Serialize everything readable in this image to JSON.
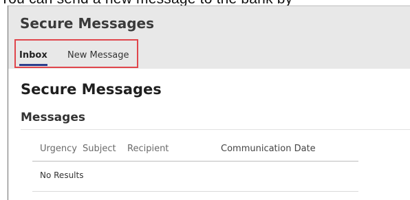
{
  "caption": {
    "text": "You can send a new message to the bank by"
  },
  "header": {
    "app_title": "Secure Messages",
    "tabs": [
      {
        "label": "Inbox",
        "active": true
      },
      {
        "label": "New Message",
        "active": false
      }
    ]
  },
  "colors": {
    "header_bg": "#e8e8e8",
    "active_tab_underline": "#2b3e8c",
    "highlight_border": "#e0454b"
  },
  "main": {
    "page_title": "Secure Messages",
    "section_title": "Messages",
    "table": {
      "columns": [
        "Urgency",
        "Subject",
        "Recipient",
        "Communication Date"
      ],
      "empty_text": "No Results"
    }
  }
}
